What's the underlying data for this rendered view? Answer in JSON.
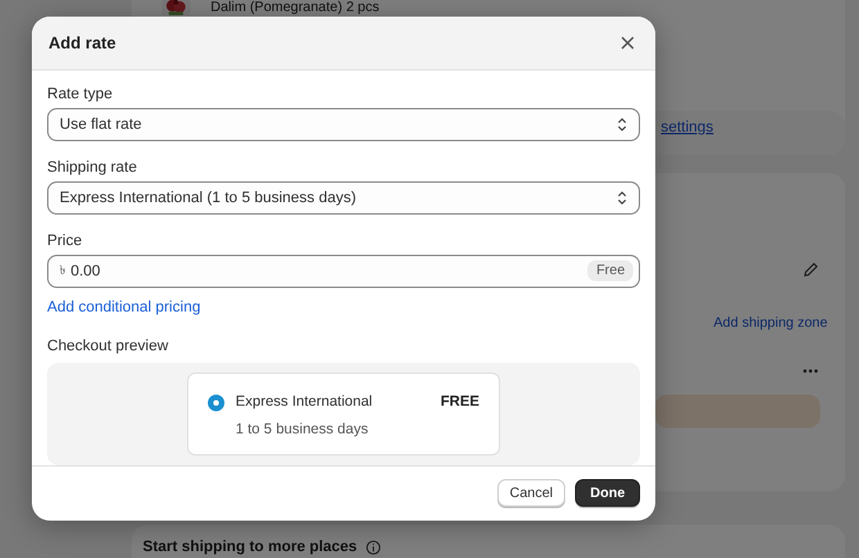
{
  "background": {
    "product": "Dalim (Pomegranate) 2 pcs",
    "settings_link": "settings",
    "zone_link": "Add shipping zone",
    "section_title": "Start shipping to more places"
  },
  "dialog": {
    "title": "Add rate",
    "fields": [
      {
        "kind": "select",
        "label": "Rate type",
        "value": "Use flat rate"
      },
      {
        "kind": "select",
        "label": "Shipping rate",
        "value": "Express International (1 to 5 business days)"
      },
      {
        "kind": "price",
        "label": "Price",
        "prefix": "৳",
        "value": "0.00",
        "badge": "Free"
      }
    ],
    "link": "Add conditional pricing",
    "preview": {
      "label": "Checkout preview",
      "name": "Express International",
      "detail": "1 to 5 business days",
      "price": "FREE",
      "selected": true
    },
    "buttons": [
      {
        "label": "Cancel",
        "kind": "secondary"
      },
      {
        "label": "Done",
        "kind": "primary"
      }
    ]
  }
}
